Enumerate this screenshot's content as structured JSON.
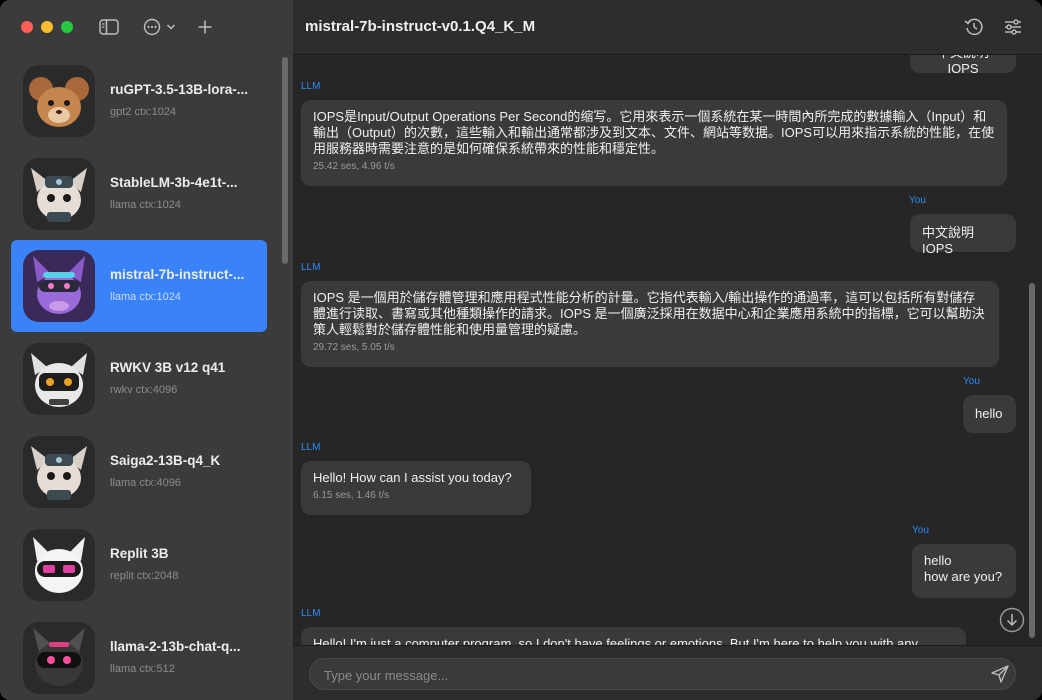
{
  "header": {
    "title": "mistral-7b-instruct-v0.1.Q4_K_M"
  },
  "sidebar": {
    "models": [
      {
        "name": "ruGPT-3.5-13B-lora-...",
        "meta": "gpt2 ctx:1024"
      },
      {
        "name": "StableLM-3b-4e1t-...",
        "meta": "llama ctx:1024"
      },
      {
        "name": "mistral-7b-instruct-...",
        "meta": "llama ctx:1024"
      },
      {
        "name": "RWKV 3B v12 q41",
        "meta": "rwkv ctx:4096"
      },
      {
        "name": "Saiga2-13B-q4_K",
        "meta": "llama ctx:4096"
      },
      {
        "name": "Replit 3B",
        "meta": "replit ctx:2048"
      },
      {
        "name": "llama-2-13b-chat-q...",
        "meta": "llama ctx:512"
      }
    ]
  },
  "chat": {
    "top_partial": "中文說明IOPS",
    "messages": [
      {
        "role": "LLM",
        "text": "IOPS是Input/Output Operations Per Second的缩写。它用來表示一個系統在某一時間內所完成的數據輸入（Input）和輸出（Output）的次數，這些輸入和輸出通常都涉及到文本、文件、網站等数据。IOPS可以用來指示系統的性能，在使用服務器時需要注意的是如何確保系統帶來的性能和穩定性。",
        "stats": "25.42 ses, 4.96 t/s"
      },
      {
        "role": "You",
        "text": "中文說明IOPS"
      },
      {
        "role": "LLM",
        "text": "IOPS 是一個用於儲存體管理和應用程式性能分析的計量。它指代表輸入/輸出操作的通過率，這可以包括所有對儲存體進行读取、書寫或其他種類操作的請求。IOPS 是一個廣泛採用在数据中心和企業應用系統中的指標，它可以幫助決策人輕鬆對於儲存體性能和使用量管理的疑慮。",
        "stats": "29.72 ses, 5.05 t/s"
      },
      {
        "role": "You",
        "text": "hello"
      },
      {
        "role": "LLM",
        "text": "Hello! How can I assist you today?",
        "stats": "6.15 ses, 1.46 t/s"
      },
      {
        "role": "You",
        "text": "hello",
        "text2": "how are you?"
      },
      {
        "role": "LLM",
        "text": "Hello! I'm just a computer program, so I don't have feelings or emotions. But I'm here to help you with any"
      }
    ]
  },
  "input": {
    "placeholder": "Type your message..."
  },
  "colors": {
    "accent": "#3a82f7",
    "role_label": "#2b8cf7",
    "bubble": "#3a3a3a"
  },
  "icons": [
    "sidebar-toggle-icon",
    "chat-options-icon",
    "chevron-down-icon",
    "new-chat-plus-icon",
    "reload-history-icon",
    "settings-sliders-icon",
    "scroll-down-icon",
    "send-icon"
  ]
}
